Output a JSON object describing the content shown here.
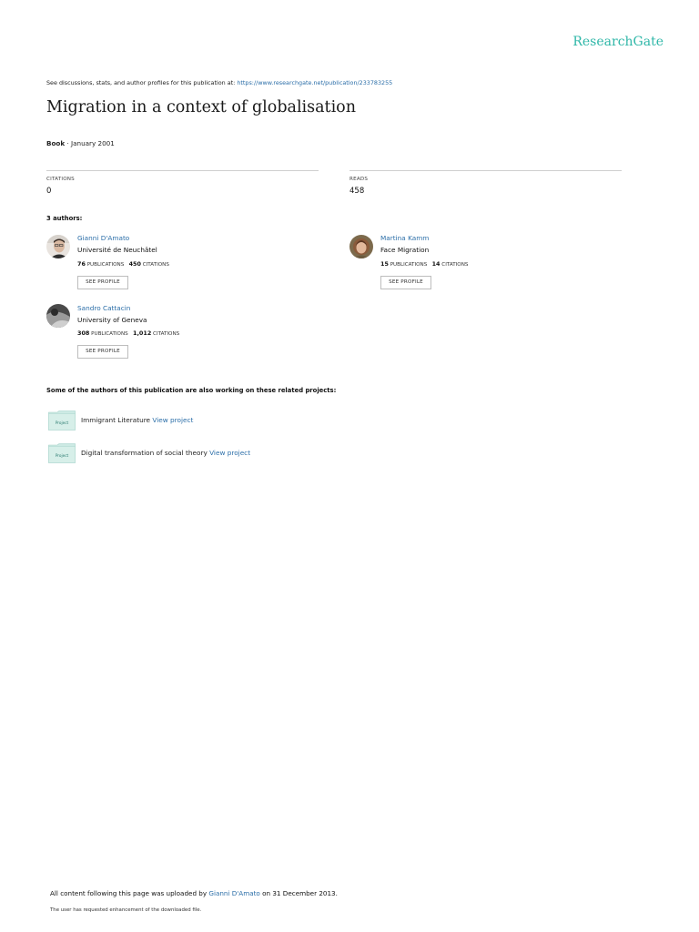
{
  "header": {
    "logo": "ResearchGate",
    "discussion_prefix": "See discussions, stats, and author profiles for this publication at: ",
    "discussion_url": "https://www.researchgate.net/publication/233783255"
  },
  "publication": {
    "title": "Migration in a context of globalisation",
    "type": "Book",
    "date_sep": " · ",
    "date": "January 2001"
  },
  "stats": {
    "citations_label": "CITATIONS",
    "citations_value": "0",
    "reads_label": "READS",
    "reads_value": "458"
  },
  "authors_heading": "3 authors:",
  "authors": [
    {
      "name": "Gianni D'Amato",
      "affiliation": "Université de Neuchâtel",
      "publications": "76",
      "publications_label": "PUBLICATIONS",
      "citations": "450",
      "citations_label": "CITATIONS",
      "button": "SEE PROFILE"
    },
    {
      "name": "Martina Kamm",
      "affiliation": "Face Migration",
      "publications": "15",
      "publications_label": "PUBLICATIONS",
      "citations": "14",
      "citations_label": "CITATIONS",
      "button": "SEE PROFILE"
    },
    {
      "name": "Sandro Cattacin",
      "affiliation": "University of Geneva",
      "publications": "308",
      "publications_label": "PUBLICATIONS",
      "citations": "1,012",
      "citations_label": "CITATIONS",
      "button": "SEE PROFILE"
    }
  ],
  "related_heading": "Some of the authors of this publication are also working on these related projects:",
  "projects": [
    {
      "icon_label": "Project",
      "name": "Immigrant Literature",
      "link": "View project"
    },
    {
      "icon_label": "Project",
      "name": "Digital transformation of social theory",
      "link": "View project"
    }
  ],
  "footer": {
    "upload_prefix": "All content following this page was uploaded by ",
    "uploader": "Gianni D'Amato",
    "upload_suffix": " on 31 December 2013.",
    "note": "The user has requested enhancement of the downloaded file."
  },
  "colors": {
    "brand": "#2fb7a8",
    "link": "#2b6ea8",
    "project_icon": "#cdeae4"
  }
}
